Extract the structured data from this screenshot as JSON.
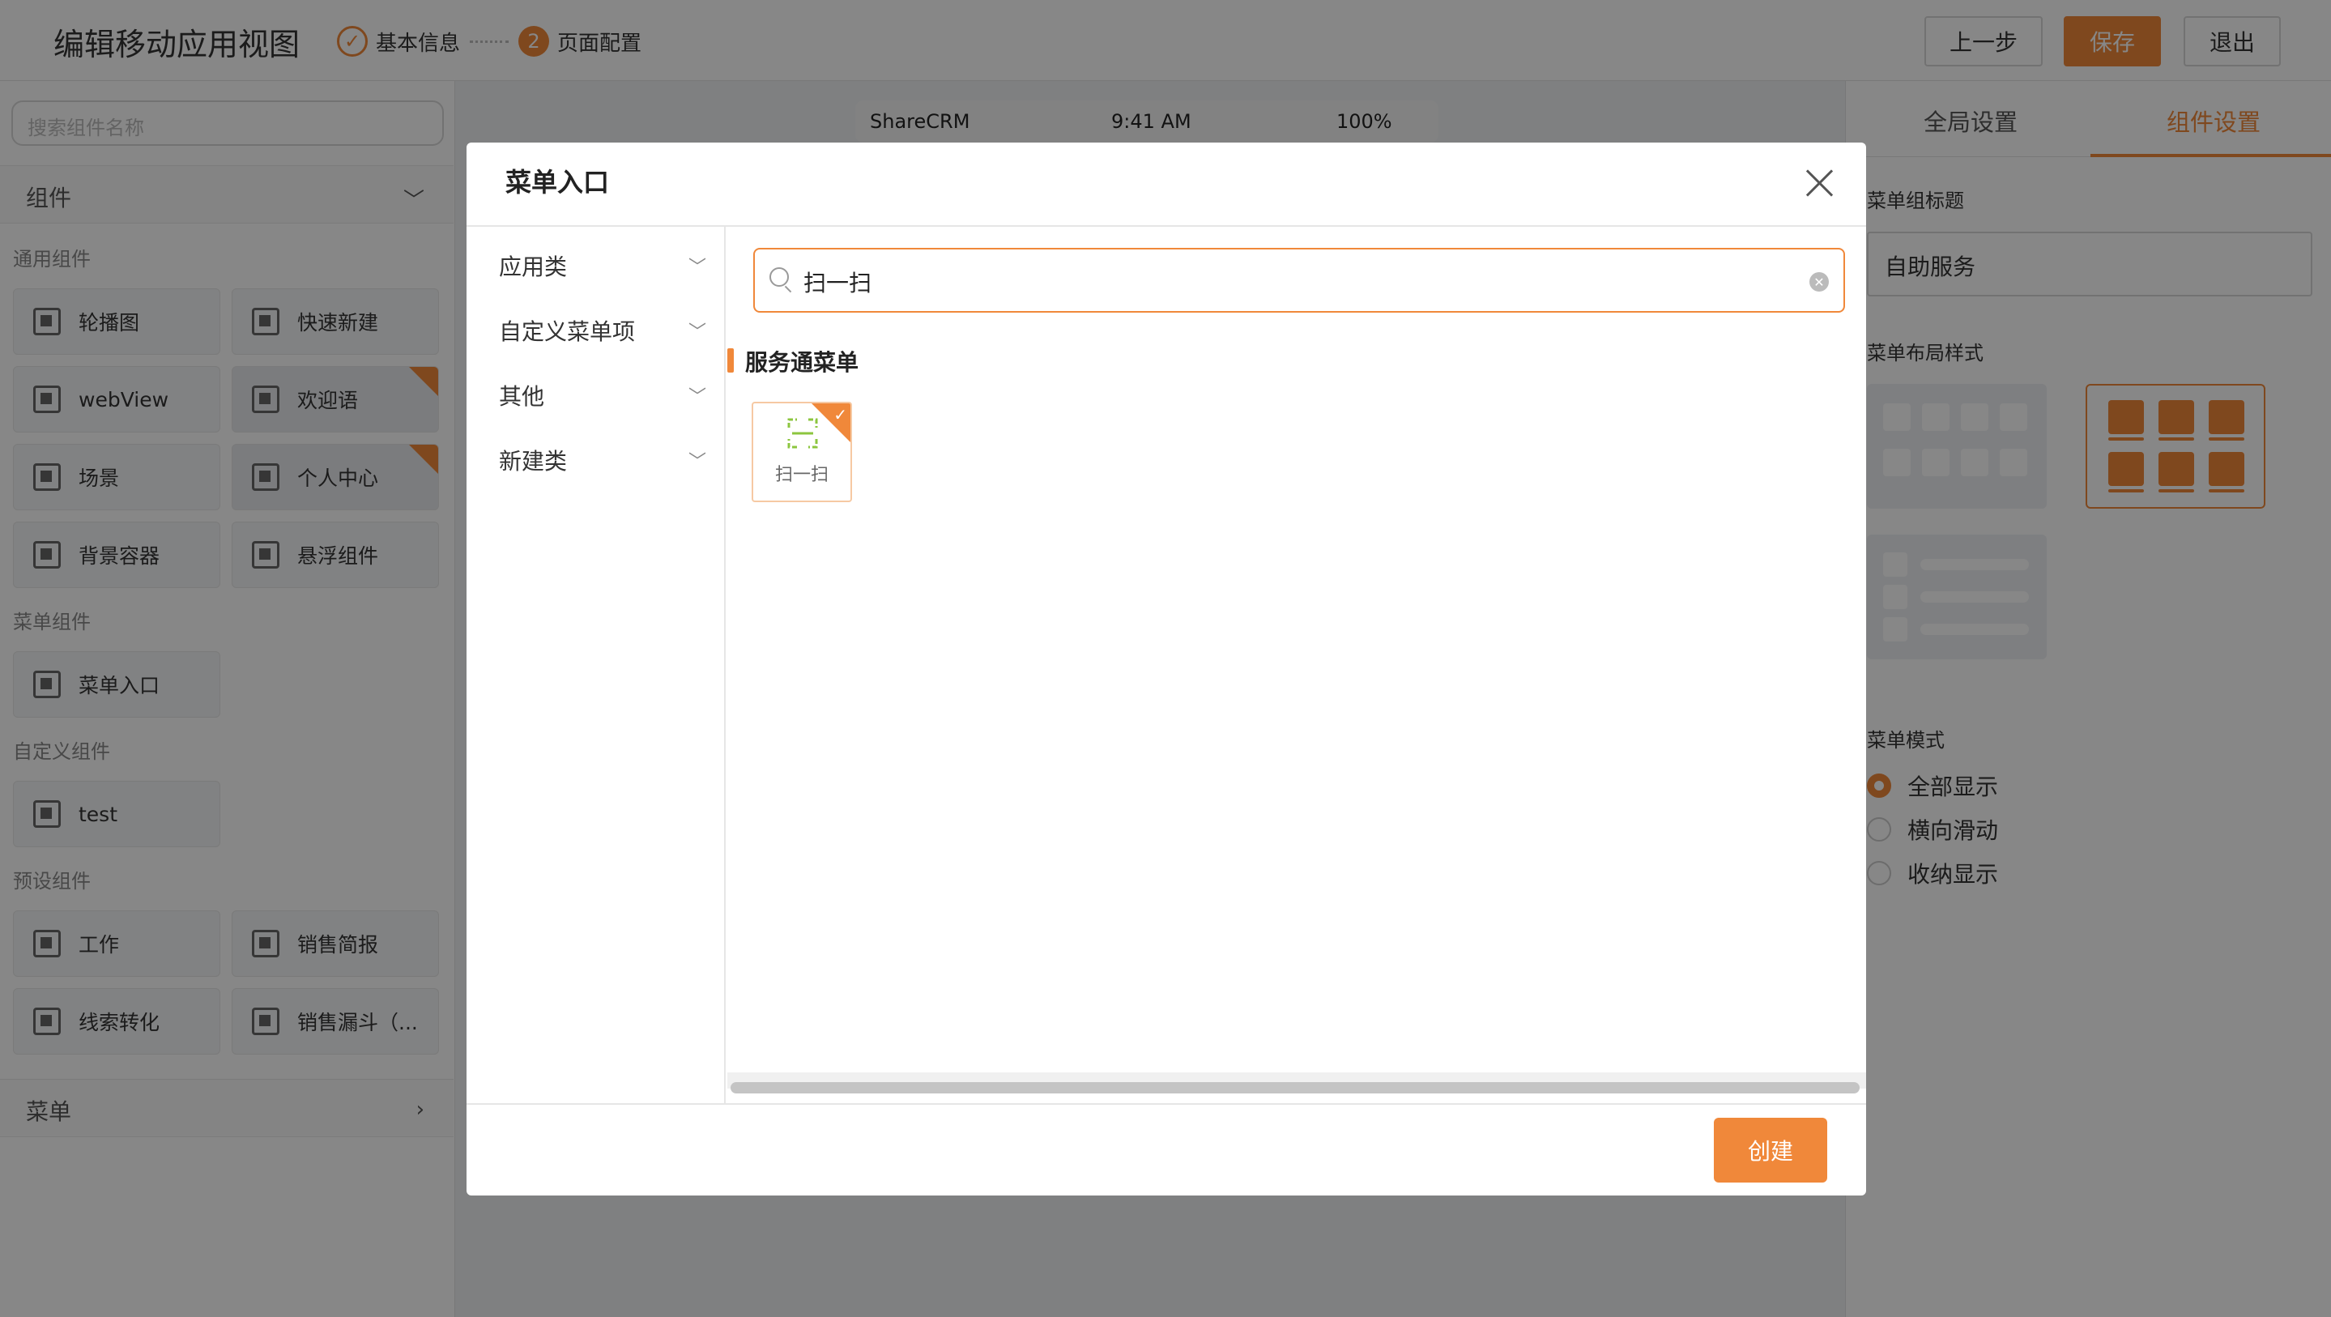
{
  "header": {
    "title": "编辑移动应用视图",
    "step1": "基本信息",
    "step2_num": "2",
    "step2": "页面配置",
    "prev": "上一步",
    "save": "保存",
    "exit": "退出"
  },
  "left": {
    "search_placeholder": "搜索组件名称",
    "components_title": "组件",
    "cat_general": "通用组件",
    "general": [
      "轮播图",
      "快速新建",
      "webView",
      "欢迎语",
      "场景",
      "个人中心",
      "背景容器",
      "悬浮组件"
    ],
    "cat_menu": "菜单组件",
    "menu_items": [
      "菜单入口"
    ],
    "cat_custom": "自定义组件",
    "custom": [
      "test"
    ],
    "cat_preset": "预设组件",
    "preset": [
      "工作",
      "销售简报",
      "线索转化",
      "销售漏斗（..."
    ],
    "menu_title": "菜单"
  },
  "phone": {
    "carrier": "ShareCRM",
    "time": "9:41 AM",
    "battery": "100%"
  },
  "right": {
    "tab_global": "全局设置",
    "tab_component": "组件设置",
    "group_title_label": "菜单组标题",
    "group_title_value": "自助服务",
    "layout_label": "菜单布局样式",
    "mode_label": "菜单模式",
    "modes": [
      "全部显示",
      "横向滑动",
      "收纳显示"
    ],
    "selected_mode": "全部显示"
  },
  "modal": {
    "title": "菜单入口",
    "categories": [
      "应用类",
      "自定义菜单项",
      "其他",
      "新建类"
    ],
    "search_value": "扫一扫",
    "section_title": "服务通菜单",
    "items": [
      "扫一扫"
    ],
    "create": "创建"
  },
  "colors": {
    "accent": "#f0883a",
    "overlay": "rgba(0,0,0,0.47)"
  }
}
